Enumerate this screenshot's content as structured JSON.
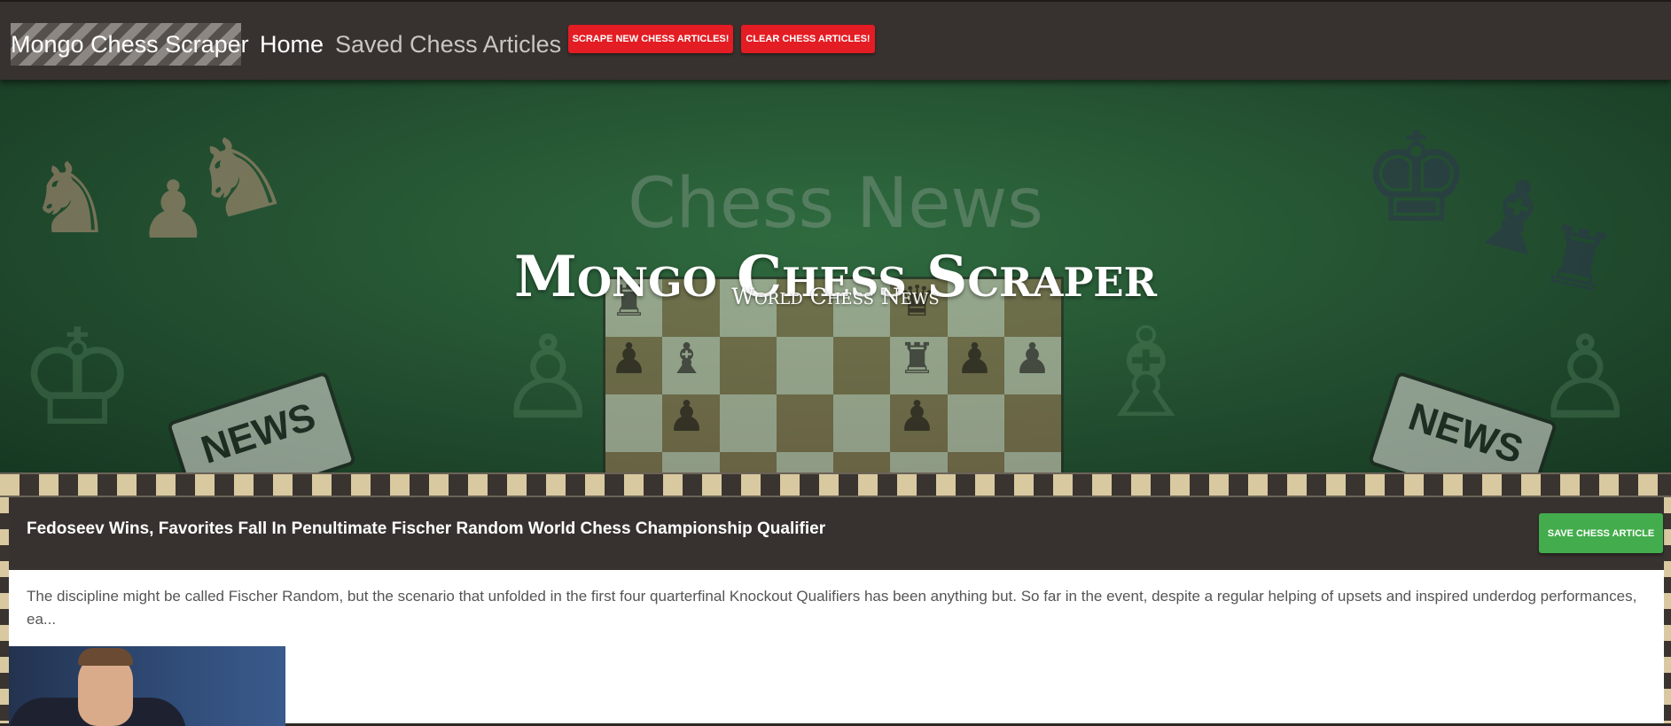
{
  "navbar": {
    "brand": "Mongo Chess Scraper",
    "links": [
      {
        "label": "Home"
      },
      {
        "label": "Saved Chess Articles"
      }
    ],
    "buttons": {
      "scrape": "Scrape New Chess Articles!",
      "clear": "Clear Chess Articles!"
    }
  },
  "hero": {
    "background_text": "Chess News",
    "title": "Mongo Chess Scraper",
    "subtitle": "World Chess News",
    "news_label": "NEWS"
  },
  "articles": [
    {
      "title": "Fedoseev Wins, Favorites Fall In Penultimate Fischer Random World Chess Championship Qualifier",
      "summary": "The discipline might be called Fischer Random, but the scenario that unfolded in the first four quarterfinal Knockout Qualifiers has been anything but. So far in the event, despite a regular helping of upsets and inspired underdog performances, ea...",
      "save_label": "Save Chess Article"
    }
  ],
  "colors": {
    "navbar_bg": "#37322f",
    "button_red": "#e41c23",
    "button_green": "#43ac4c",
    "hero_green": "#234f30"
  }
}
